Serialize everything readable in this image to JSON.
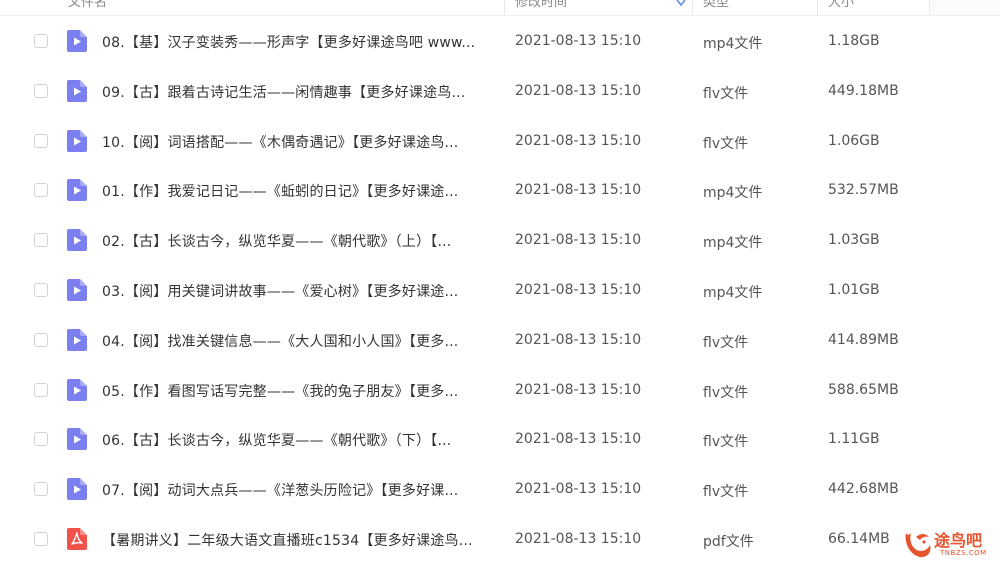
{
  "header": {
    "col_name": "文件名",
    "col_time": "修改时间",
    "col_type": "类型",
    "col_size": "大小"
  },
  "rows": [
    {
      "icon": "video-file-icon",
      "name": "08.【基】汉子变装秀——形声字【更多好课途鸟吧 www...",
      "time": "2021-08-13 15:10",
      "type": "mp4文件",
      "size": "1.18GB"
    },
    {
      "icon": "video-file-icon",
      "name": "09.【古】跟着古诗记生活——闲情趣事【更多好课途鸟...",
      "time": "2021-08-13 15:10",
      "type": "flv文件",
      "size": "449.18MB"
    },
    {
      "icon": "video-file-icon",
      "name": "10.【阅】词语搭配——《木偶奇遇记》【更多好课途鸟...",
      "time": "2021-08-13 15:10",
      "type": "flv文件",
      "size": "1.06GB"
    },
    {
      "icon": "video-file-icon",
      "name": "01.【作】我爱记日记——《蚯蚓的日记》【更多好课途...",
      "time": "2021-08-13 15:10",
      "type": "mp4文件",
      "size": "532.57MB"
    },
    {
      "icon": "video-file-icon",
      "name": "02.【古】长谈古今，纵览华夏——《朝代歌》（上）【...",
      "time": "2021-08-13 15:10",
      "type": "mp4文件",
      "size": "1.03GB"
    },
    {
      "icon": "video-file-icon",
      "name": "03.【阅】用关键词讲故事——《爱心树》【更多好课途...",
      "time": "2021-08-13 15:10",
      "type": "mp4文件",
      "size": "1.01GB"
    },
    {
      "icon": "video-file-icon",
      "name": "04.【阅】找准关键信息——《大人国和小人国》【更多...",
      "time": "2021-08-13 15:10",
      "type": "flv文件",
      "size": "414.89MB"
    },
    {
      "icon": "video-file-icon",
      "name": "05.【作】看图写话写完整——《我的兔子朋友》【更多...",
      "time": "2021-08-13 15:10",
      "type": "flv文件",
      "size": "588.65MB"
    },
    {
      "icon": "video-file-icon",
      "name": "06.【古】长谈古今，纵览华夏——《朝代歌》（下）【...",
      "time": "2021-08-13 15:10",
      "type": "flv文件",
      "size": "1.11GB"
    },
    {
      "icon": "video-file-icon",
      "name": "07.【阅】动词大点兵——《洋葱头历险记》【更多好课...",
      "time": "2021-08-13 15:10",
      "type": "flv文件",
      "size": "442.68MB"
    },
    {
      "icon": "pdf-file-icon",
      "name": "【暑期讲义】二年级大语文直播班c1534【更多好课途鸟...",
      "time": "2021-08-13 15:10",
      "type": "pdf文件",
      "size": "66.14MB"
    }
  ],
  "watermark": {
    "text": "途鸟吧",
    "sub": "TNBZS.COM"
  },
  "colors": {
    "video_icon": "#7b7ff0",
    "pdf_icon": "#f0524a",
    "watermark": "#e8542e"
  }
}
